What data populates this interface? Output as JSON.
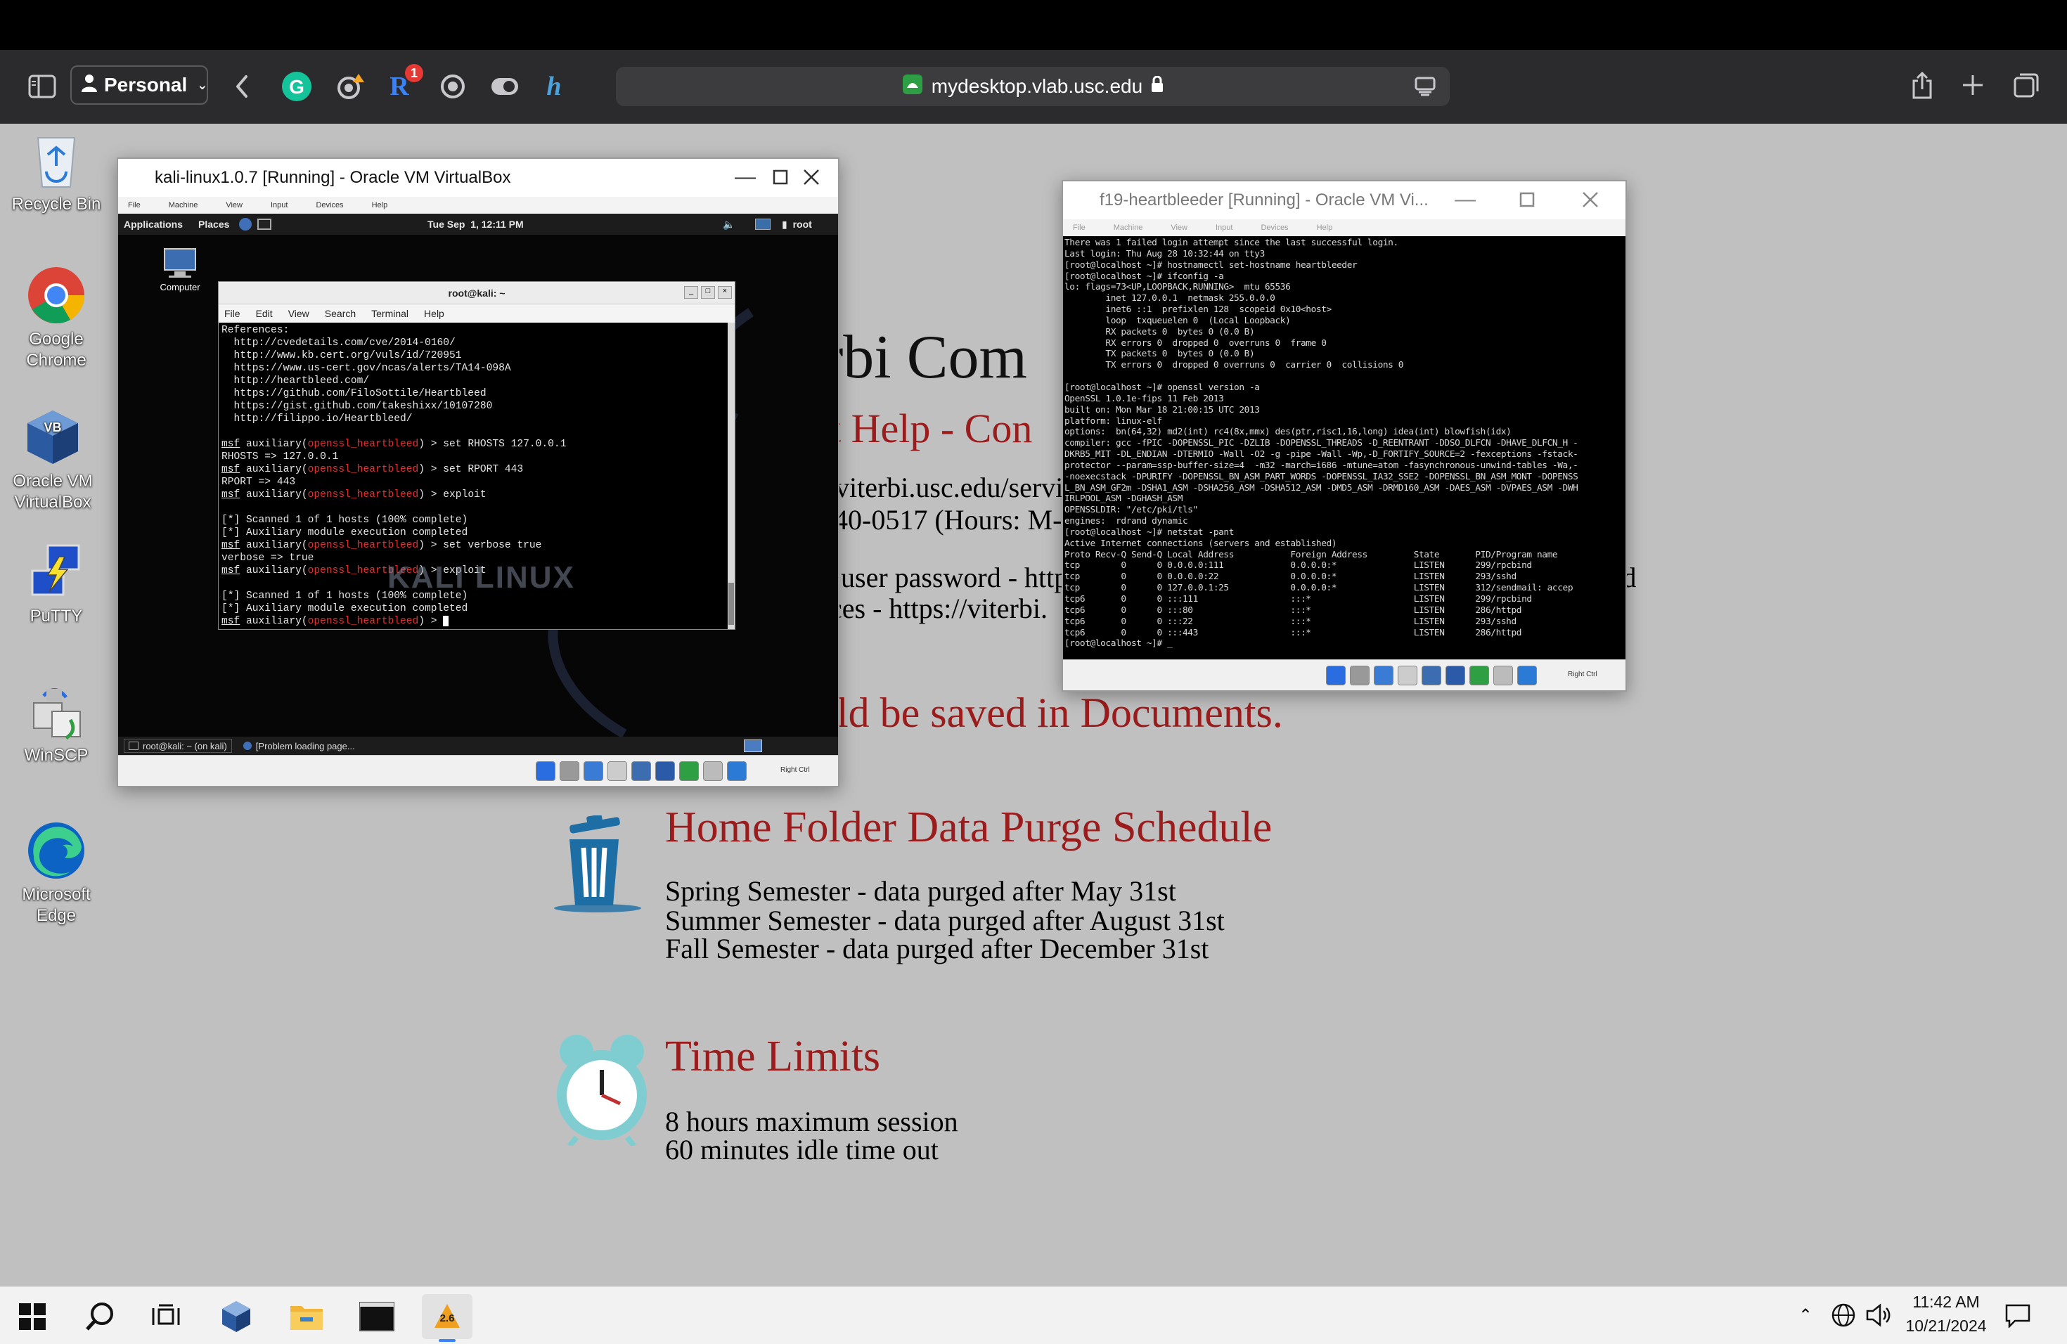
{
  "browser": {
    "profile_label": "Personal",
    "url": "mydesktop.vlab.usc.edu",
    "ext_badge": "1",
    "colors": {
      "toolbar": "#2b2b2d",
      "grammarly": "#15c39a",
      "readwise": "#3b82f6"
    }
  },
  "desktop": {
    "icons": [
      {
        "label": "Recycle Bin",
        "icon": "recycle-bin-icon"
      },
      {
        "label": "Google Chrome",
        "icon": "chrome-icon"
      },
      {
        "label": "Oracle VM VirtualBox",
        "icon": "virtualbox-icon"
      },
      {
        "label": "PuTTY",
        "icon": "putty-icon"
      },
      {
        "label": "WinSCP",
        "icon": "winscp-icon"
      },
      {
        "label": "Microsoft Edge",
        "icon": "edge-icon"
      }
    ]
  },
  "background_slide": {
    "title_fragment": "rbi Com",
    "subtitle_fragment": "t Help - Con",
    "line1_fragment": "viterbi.usc.edu/servi",
    "line2_fragment": "40-0517 (Hours: M-",
    "line3_fragment": "user password - http",
    "line3_tail": "rd",
    "line4_fragment": "ces - https://viterbi.",
    "line5_fragment": "ld be saved in Documents.",
    "purge_heading": "Home Folder Data Purge Schedule",
    "purge_lines": [
      "Spring Semester - data purged after May 31st",
      "Summer Semester - data purged after August 31st",
      "Fall Semester - data purged after December 31st"
    ],
    "time_heading": "Time Limits",
    "time_lines": [
      "8 hours maximum session",
      "60 minutes idle time out"
    ]
  },
  "kali_window": {
    "title": "kali-linux1.0.7 [Running] - Oracle VM VirtualBox",
    "menu": [
      "File",
      "Machine",
      "View",
      "Input",
      "Devices",
      "Help"
    ],
    "panel": {
      "applications": "Applications",
      "places": "Places",
      "clock": "Tue Sep  1, 12:11 PM",
      "user": "root"
    },
    "computer_icon_label": "Computer",
    "terminal": {
      "title": "root@kali: ~",
      "menu": [
        "File",
        "Edit",
        "View",
        "Search",
        "Terminal",
        "Help"
      ],
      "lines": [
        "References:",
        "  http://cvedetails.com/cve/2014-0160/",
        "  http://www.kb.cert.org/vuls/id/720951",
        "  https://www.us-cert.gov/ncas/alerts/TA14-098A",
        "  http://heartbleed.com/",
        "  https://github.com/FiloSottile/Heartbleed",
        "  https://gist.github.com/takeshixx/10107280",
        "  http://filippo.io/Heartbleed/",
        "",
        "msf auxiliary(openssl_heartbleed) > set RHOSTS 127.0.0.1",
        "RHOSTS => 127.0.0.1",
        "msf auxiliary(openssl_heartbleed) > set RPORT 443",
        "RPORT => 443",
        "msf auxiliary(openssl_heartbleed) > exploit",
        "",
        "[*] Scanned 1 of 1 hosts (100% complete)",
        "[*] Auxiliary module execution completed",
        "msf auxiliary(openssl_heartbleed) > set verbose true",
        "verbose => true",
        "msf auxiliary(openssl_heartbleed) > exploit",
        "",
        "[*] Scanned 1 of 1 hosts (100% complete)",
        "[*] Auxiliary module execution completed",
        "msf auxiliary(openssl_heartbleed) > "
      ],
      "watermark": "KALI LINUX"
    },
    "bottom_tasks": [
      "root@kali: ~ (on kali)",
      "[Problem loading page..."
    ],
    "host_key": "Right Ctrl"
  },
  "heartbleeder_window": {
    "title": "f19-heartbleeder [Running] - Oracle VM Vi...",
    "menu": [
      "File",
      "Machine",
      "View",
      "Input",
      "Devices",
      "Help"
    ],
    "console": [
      "There was 1 failed login attempt since the last successful login.",
      "Last login: Thu Aug 28 10:32:44 on tty3",
      "[root@localhost ~]# hostnamectl set-hostname heartbleeder",
      "[root@localhost ~]# ifconfig -a",
      "lo: flags=73<UP,LOOPBACK,RUNNING>  mtu 65536",
      "        inet 127.0.0.1  netmask 255.0.0.0",
      "        inet6 ::1  prefixlen 128  scopeid 0x10<host>",
      "        loop  txqueuelen 0  (Local Loopback)",
      "        RX packets 0  bytes 0 (0.0 B)",
      "        RX errors 0  dropped 0  overruns 0  frame 0",
      "        TX packets 0  bytes 0 (0.0 B)",
      "        TX errors 0  dropped 0 overruns 0  carrier 0  collisions 0",
      "",
      "[root@localhost ~]# openssl version -a",
      "OpenSSL 1.0.1e-fips 11 Feb 2013",
      "built on: Mon Mar 18 21:00:15 UTC 2013",
      "platform: linux-elf",
      "options:  bn(64,32) md2(int) rc4(8x,mmx) des(ptr,risc1,16,long) idea(int) blowfish(idx)",
      "compiler: gcc -fPIC -DOPENSSL_PIC -DZLIB -DOPENSSL_THREADS -D_REENTRANT -DDSO_DLFCN -DHAVE_DLFCN_H -",
      "DKRB5_MIT -DL_ENDIAN -DTERMIO -Wall -O2 -g -pipe -Wall -Wp,-D_FORTIFY_SOURCE=2 -fexceptions -fstack-",
      "protector --param=ssp-buffer-size=4  -m32 -march=i686 -mtune=atom -fasynchronous-unwind-tables -Wa,-",
      "-noexecstack -DPURIFY -DOPENSSL_BN_ASM_PART_WORDS -DOPENSSL_IA32_SSE2 -DOPENSSL_BN_ASM_MONT -DOPENSS",
      "L_BN_ASM_GF2m -DSHA1_ASM -DSHA256_ASM -DSHA512_ASM -DMD5_ASM -DRMD160_ASM -DAES_ASM -DVPAES_ASM -DWH",
      "IRLPOOL_ASM -DGHASH_ASM",
      "OPENSSLDIR: \"/etc/pki/tls\"",
      "engines:  rdrand dynamic",
      "[root@localhost ~]# netstat -pant",
      "Active Internet connections (servers and established)",
      "Proto Recv-Q Send-Q Local Address           Foreign Address         State       PID/Program name",
      "tcp        0      0 0.0.0.0:111             0.0.0.0:*               LISTEN      299/rpcbind",
      "tcp        0      0 0.0.0.0:22              0.0.0.0:*               LISTEN      293/sshd",
      "tcp        0      0 127.0.0.1:25            0.0.0.0:*               LISTEN      312/sendmail: accep",
      "tcp6       0      0 :::111                  :::*                    LISTEN      299/rpcbind",
      "tcp6       0      0 :::80                   :::*                    LISTEN      286/httpd",
      "tcp6       0      0 :::22                   :::*                    LISTEN      293/sshd",
      "tcp6       0      0 :::443                  :::*                    LISTEN      286/httpd",
      "[root@localhost ~]# _"
    ],
    "host_key": "Right Ctrl"
  },
  "taskbar": {
    "active_badge": "2.6",
    "time": "11:42 AM",
    "date": "10/21/2024"
  }
}
